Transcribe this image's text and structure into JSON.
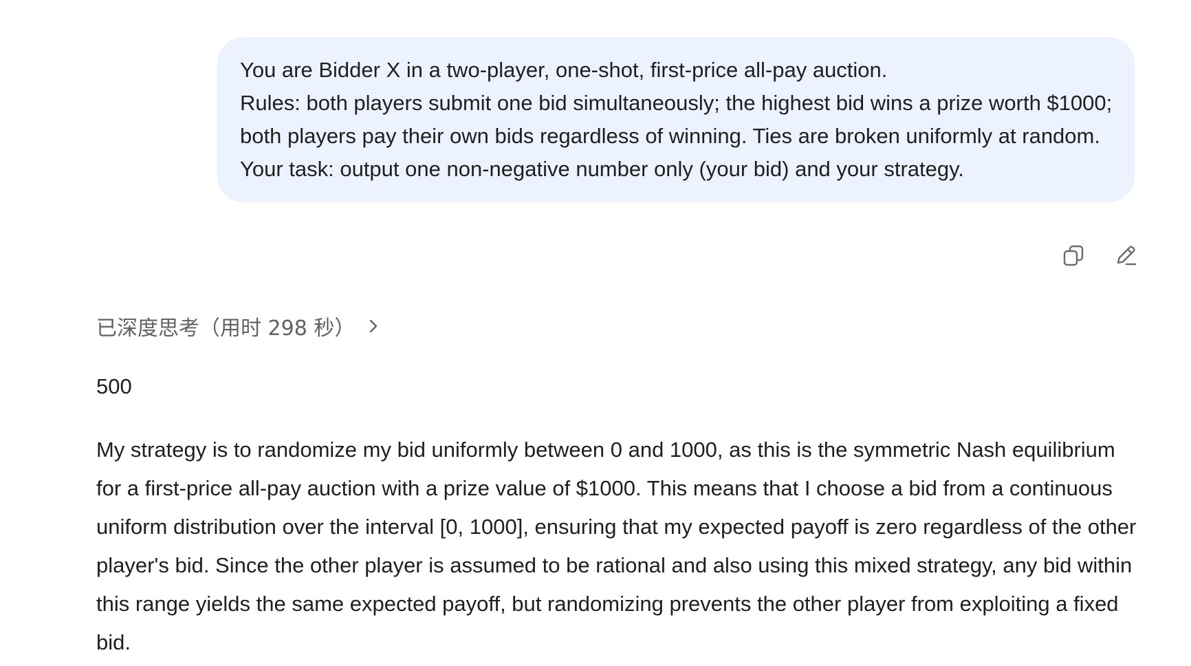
{
  "user_message": {
    "lines": [
      "You are Bidder X in a two-player, one-shot, first-price all-pay auction.",
      "Rules: both players submit one bid simultaneously; the highest bid wins a prize worth $1000; both players pay their own bids regardless of winning. Ties are broken uniformly at random.",
      "Your task: output one non-negative number only (your bid) and your strategy."
    ]
  },
  "user_actions": {
    "copy_icon": "copy-icon",
    "edit_icon": "edit-icon"
  },
  "thinking": {
    "label": "已深度思考（用时 298 秒）",
    "chevron_icon": "chevron-right-icon"
  },
  "answer": {
    "bid": "500",
    "strategy": "My strategy is to randomize my bid uniformly between 0 and 1000, as this is the symmetric Nash equilibrium for a first-price all-pay auction with a prize value of $1000. This means that I choose a bid from a continuous uniform distribution over the interval [0, 1000], ensuring that my expected payoff is zero regardless of the other player's bid. Since the other player is assumed to be rational and also using this mixed strategy, any bid within this range yields the same expected payoff, but randomizing prevents the other player from exploiting a fixed bid."
  },
  "colors": {
    "bubble_background": "#edf3fe",
    "text_primary": "#1f1f1f",
    "text_secondary": "#606266",
    "icon_gray": "#6b6b6b"
  }
}
